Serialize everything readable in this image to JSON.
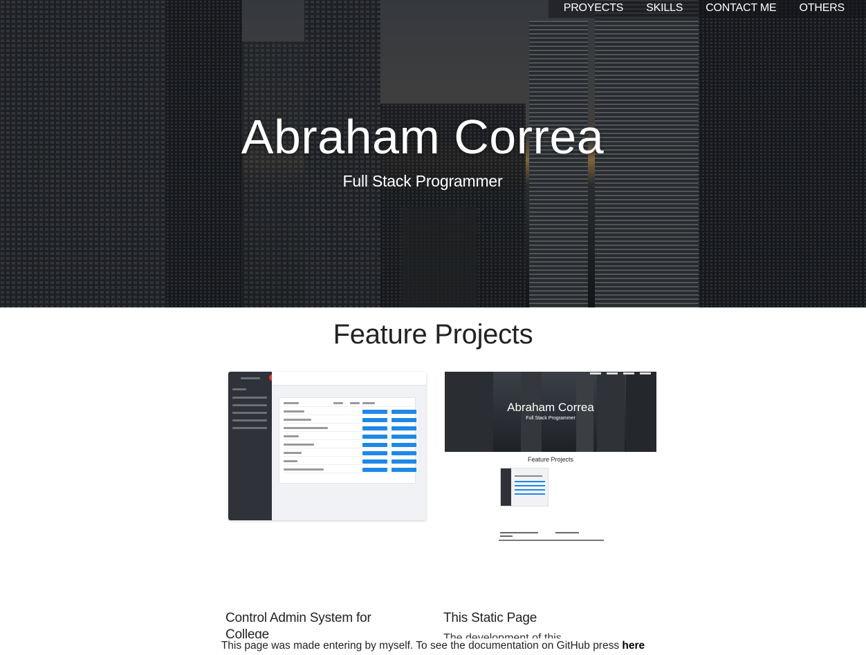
{
  "nav": {
    "items": [
      "PROYECTS",
      "SKILLS",
      "CONTACT ME",
      "OTHERS"
    ]
  },
  "hero": {
    "title": "Abraham Correa",
    "subtitle": "Full Stack Programmer"
  },
  "projects": {
    "section_title": "Feature Projects",
    "cards": [
      {
        "title": "Control Admin System for College"
      },
      {
        "title": "This Static Page",
        "description": "The development of this"
      }
    ],
    "preview": {
      "title": "Abraham Correa",
      "subtitle": "Full Stack Programmer",
      "section_title": "Feature Projects"
    }
  },
  "footer": {
    "text": "This page was made entering by myself. To see the documentation on GitHub press ",
    "link": "here"
  },
  "colors": {
    "button_blue": "#1e88e5",
    "close_red": "#e53935",
    "sidebar_dark": "#2f3238"
  }
}
